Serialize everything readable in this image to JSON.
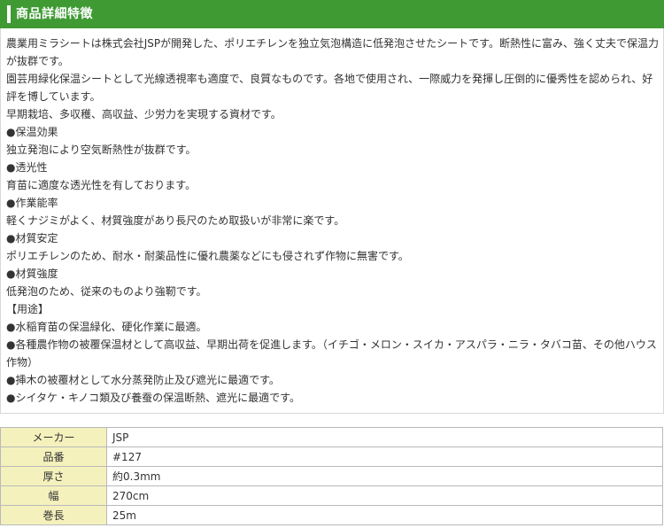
{
  "section": {
    "title": "商品詳細特徴"
  },
  "description": [
    "農業用ミラシートは株式会社JSPが開発した、ポリエチレンを独立気泡構造に低発泡させたシートです。断熱性に富み、強く丈夫で保温力が抜群です。",
    "園芸用緑化保温シートとして光線透視率も適度で、良質なものです。各地で使用され、一際威力を発揮し圧倒的に優秀性を認められ、好評を博しています。",
    "早期栽培、多収穫、高収益、少労力を実現する資材です。",
    "●保温効果",
    "独立発泡により空気断熱性が抜群です。",
    "●透光性",
    "育苗に適度な透光性を有しております。",
    "●作業能率",
    "軽くナジミがよく、材質強度があり長尺のため取扱いが非常に楽です。",
    "●材質安定",
    "ポリエチレンのため、耐水・耐薬品性に優れ農薬などにも侵されず作物に無害です。",
    "●材質強度",
    "低発泡のため、従来のものより強靭です。",
    "【用途】",
    "●水稲育苗の保温緑化、硬化作業に最適。",
    "●各種農作物の被覆保温材として高収益、早期出荷を促進します。（イチゴ・メロン・スイカ・アスパラ・ニラ・タバコ苗、その他ハウス作物）",
    "●挿木の被覆材として水分蒸発防止及び遮光に最適です。",
    "●シイタケ・キノコ類及び養蚕の保温断熱、遮光に最適です。"
  ],
  "specs": [
    {
      "label": "メーカー",
      "value": "JSP"
    },
    {
      "label": "品番",
      "value": "#127"
    },
    {
      "label": "厚さ",
      "value": "約0.3mm"
    },
    {
      "label": "幅",
      "value": "270cm"
    },
    {
      "label": "巻長",
      "value": "25m"
    }
  ],
  "colors": {
    "header_green": "#3f9a34",
    "spec_label_bg": "#f4f1bd",
    "border": "#b9b9b9"
  }
}
